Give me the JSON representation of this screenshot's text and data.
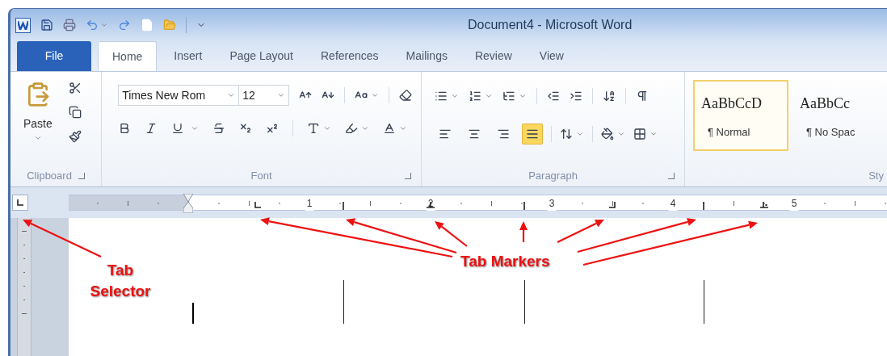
{
  "window": {
    "title": "Document4 - Microsoft Word"
  },
  "ribbon_tabs": [
    {
      "label": "File",
      "kind": "file",
      "selected": false
    },
    {
      "label": "Home",
      "kind": "tab",
      "selected": true
    },
    {
      "label": "Insert",
      "kind": "tab",
      "selected": false
    },
    {
      "label": "Page Layout",
      "kind": "tab",
      "selected": false
    },
    {
      "label": "References",
      "kind": "tab",
      "selected": false
    },
    {
      "label": "Mailings",
      "kind": "tab",
      "selected": false
    },
    {
      "label": "Review",
      "kind": "tab",
      "selected": false
    },
    {
      "label": "View",
      "kind": "tab",
      "selected": false
    }
  ],
  "clipboard": {
    "paste": "Paste",
    "label": "Clipboard"
  },
  "font": {
    "name": "Times New Rom",
    "size": "12",
    "label": "Font"
  },
  "paragraph": {
    "label": "Paragraph",
    "alignments": [
      {
        "selected": false
      },
      {
        "selected": false
      },
      {
        "selected": false
      },
      {
        "selected": true
      }
    ]
  },
  "styles": {
    "label": "Sty",
    "items": [
      {
        "preview": "AaBbCcD",
        "name": "¶ Normal",
        "selected": true
      },
      {
        "preview": "AaBbCc",
        "name": "¶ No Spac",
        "selected": false
      }
    ]
  },
  "ruler": {
    "numbers": [
      "1",
      "2",
      "3",
      "4",
      "5"
    ],
    "tab_stops": [
      {
        "kind": "left"
      },
      {
        "kind": "bar"
      },
      {
        "kind": "center"
      },
      {
        "kind": "bar"
      },
      {
        "kind": "right"
      },
      {
        "kind": "bar"
      },
      {
        "kind": "decimal"
      }
    ]
  },
  "annotations": [
    {
      "text": "Tab Selector"
    },
    {
      "text": "Tab Markers"
    }
  ]
}
